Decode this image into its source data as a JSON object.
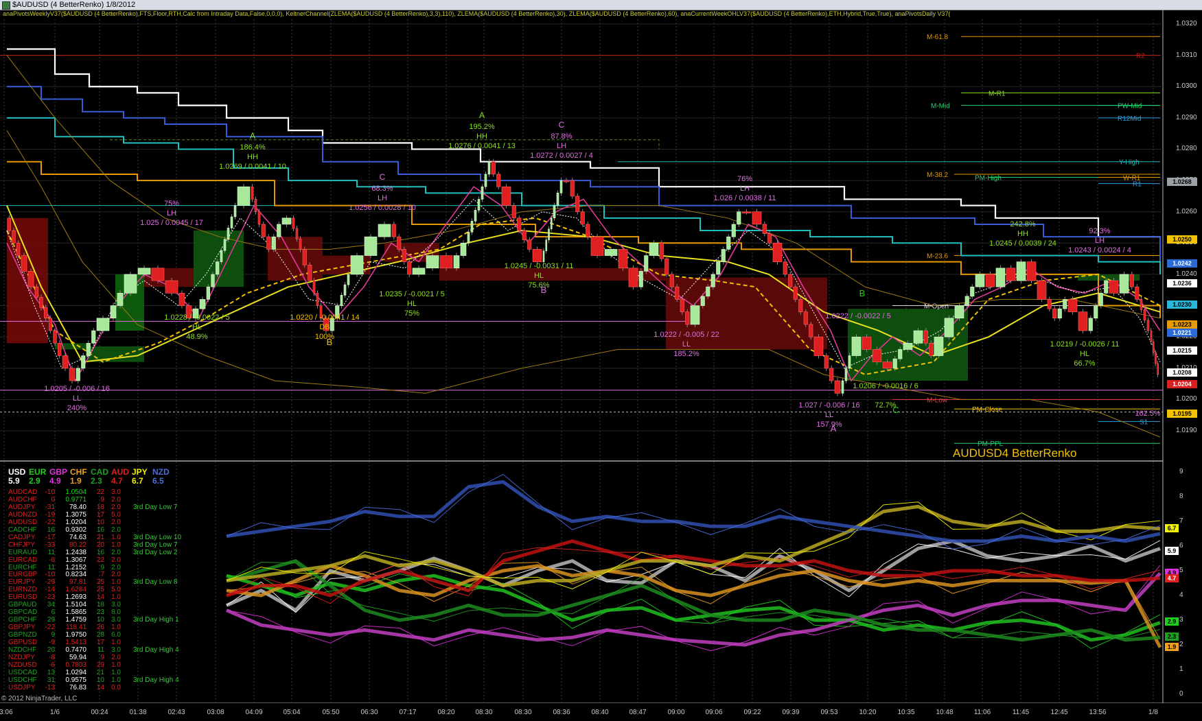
{
  "window": {
    "title": "$AUDUSD (4 BetterRenko)  1/8/2012"
  },
  "indicator_line": "anaPivotsWeeklyV37($AUDUSD (4 BetterRenko),FTS,Floor,RTH,Calc from Intraday Data,False,0,0,0), KeltnerChannel(ZLEMA($AUDUSD (4 BetterRenko),3,3),110), ZLEMA($AUDUSD (4 BetterRenko),30), ZLEMA($AUDUSD (4 BetterRenko),60), anaCurrentWeekOHLV37($AUDUSD (4 BetterRenko),ETH,Hybrid,True,True), anaPivotsDaily V37(",
  "instrument_label": "AUDUSD4 BetterRenko",
  "copyright": "© 2012 NinjaTrader, LLC",
  "price_axis": [
    "1.0320",
    "1.0310",
    "1.0300",
    "1.0290",
    "1.0280",
    "1.0270",
    "1.0260",
    "1.0250",
    "1.0240",
    "1.0230",
    "1.0220",
    "1.0210",
    "1.0200",
    "1.0190"
  ],
  "price_badges": [
    {
      "value": "1.0268",
      "color": "#9aa0a6",
      "text": "#000"
    },
    {
      "value": "1.0250",
      "color": "#f2c200",
      "text": "#000"
    },
    {
      "value": "1.0242",
      "color": "#2b6bd8",
      "text": "#fff"
    },
    {
      "value": "1.0236",
      "color": "#ffffff",
      "text": "#000"
    },
    {
      "value": "1.0230",
      "color": "#29b6d8",
      "text": "#000"
    },
    {
      "value": "1.0223",
      "color": "#e69a00",
      "text": "#000"
    },
    {
      "value": "1.0221",
      "color": "#2b6bd8",
      "text": "#fff"
    },
    {
      "value": "1.0215",
      "color": "#ffffff",
      "text": "#000"
    },
    {
      "value": "1.0208",
      "color": "#ffffff",
      "text": "#000"
    },
    {
      "value": "1.0204",
      "color": "#d82020",
      "text": "#fff"
    },
    {
      "value": "1.0195",
      "color": "#f2c200",
      "text": "#000"
    }
  ],
  "strength_axis": [
    "9",
    "8",
    "7",
    "6",
    "5",
    "4",
    "3",
    "2",
    "1",
    "0"
  ],
  "strength_badges": [
    {
      "value": "6.7",
      "color": "#f2f200",
      "text": "#000"
    },
    {
      "value": "5.9",
      "color": "#ffffff",
      "text": "#000"
    },
    {
      "value": "4.9",
      "color": "#e030e0",
      "text": "#000"
    },
    {
      "value": "4.7",
      "color": "#e02020",
      "text": "#fff"
    },
    {
      "value": "2.9",
      "color": "#20d020",
      "text": "#000"
    },
    {
      "value": "2.3",
      "color": "#20a020",
      "text": "#000"
    },
    {
      "value": "1.9",
      "color": "#f0a020",
      "text": "#000"
    }
  ],
  "time_axis": [
    "23:06",
    "1/6",
    "00:24",
    "01:38",
    "02:43",
    "03:08",
    "04:09",
    "05:04",
    "05:50",
    "06:30",
    "07:17",
    "08:20",
    "08:30",
    "08:30",
    "08:36",
    "08:40",
    "08:47",
    "09:00",
    "09:06",
    "09:22",
    "09:39",
    "09:53",
    "10:20",
    "10:35",
    "10:48",
    "11:06",
    "11:45",
    "12:45",
    "13:56",
    "1/8"
  ],
  "currencies": [
    {
      "code": "USD",
      "value": "5.9",
      "color": "#ffffff"
    },
    {
      "code": "EUR",
      "value": "2.9",
      "color": "#20d020"
    },
    {
      "code": "GBP",
      "value": "4.9",
      "color": "#e030e0"
    },
    {
      "code": "CHF",
      "value": "1.9",
      "color": "#f0a020"
    },
    {
      "code": "CAD",
      "value": "2.3",
      "color": "#20a020"
    },
    {
      "code": "AUD",
      "value": "4.7",
      "color": "#e02020"
    },
    {
      "code": "JPY",
      "value": "6.7",
      "color": "#f2f200"
    },
    {
      "code": "NZD",
      "value": "6.5",
      "color": "#4a6ee0"
    }
  ],
  "pairs": [
    {
      "name": "AUDCAD",
      "a": "-10",
      "price": "1.0504",
      "b": "22",
      "c": "3.0",
      "note": "",
      "color": "#e02020",
      "pcolor": "#20d020"
    },
    {
      "name": "AUDCHF",
      "a": "0",
      "price": "0.9771",
      "b": "9",
      "c": "2.0",
      "note": "",
      "color": "#e02020",
      "pcolor": "#20d020"
    },
    {
      "name": "AUDJPY",
      "a": "-31",
      "price": "78.40",
      "b": "18",
      "c": "2.0",
      "note": "3rd Day Low 7",
      "color": "#e02020",
      "pcolor": "#ffffff"
    },
    {
      "name": "AUDNZD",
      "a": "-19",
      "price": "1.3075",
      "b": "17",
      "c": "5.0",
      "note": "",
      "color": "#e02020",
      "pcolor": "#ffffff"
    },
    {
      "name": "AUDUSD",
      "a": "-22",
      "price": "1.0204",
      "b": "10",
      "c": "2.0",
      "note": "",
      "color": "#e02020",
      "pcolor": "#ffffff"
    },
    {
      "name": "CADCHF",
      "a": "16",
      "price": "0.9302",
      "b": "16",
      "c": "2.0",
      "note": "",
      "color": "#20a020",
      "pcolor": "#ffffff"
    },
    {
      "name": "CADJPY",
      "a": "-17",
      "price": "74.63",
      "b": "21",
      "c": "1.0",
      "note": "3rd Day Low 10",
      "color": "#e02020",
      "pcolor": "#ffffff"
    },
    {
      "name": "CHFJPY",
      "a": "-33",
      "price": "80.22",
      "b": "20",
      "c": "1.0",
      "note": "3rd Day Low 7",
      "color": "#e02020",
      "pcolor": "#e02020"
    },
    {
      "name": "EURAUD",
      "a": "11",
      "price": "1.2438",
      "b": "16",
      "c": "2.0",
      "note": "3rd Day Low 2",
      "color": "#20a020",
      "pcolor": "#ffffff"
    },
    {
      "name": "EURCAD",
      "a": "-6",
      "price": "1.3067",
      "b": "22",
      "c": "2.0",
      "note": "",
      "color": "#e02020",
      "pcolor": "#ffffff"
    },
    {
      "name": "EURCHF",
      "a": "11",
      "price": "1.2152",
      "b": "9",
      "c": "2.0",
      "note": "",
      "color": "#20a020",
      "pcolor": "#ffffff"
    },
    {
      "name": "EURGBP",
      "a": "-10",
      "price": "0.8234",
      "b": "7",
      "c": "2.0",
      "note": "",
      "color": "#e02020",
      "pcolor": "#ffffff"
    },
    {
      "name": "EURJPY",
      "a": "-29",
      "price": "97.81",
      "b": "25",
      "c": "1.0",
      "note": "3rd Day Low 8",
      "color": "#e02020",
      "pcolor": "#e02020"
    },
    {
      "name": "EURNZD",
      "a": "-14",
      "price": "1.6284",
      "b": "25",
      "c": "5.0",
      "note": "",
      "color": "#e02020",
      "pcolor": "#e02020"
    },
    {
      "name": "EURUSD",
      "a": "-23",
      "price": "1.2693",
      "b": "14",
      "c": "1.0",
      "note": "",
      "color": "#e02020",
      "pcolor": "#ffffff"
    },
    {
      "name": "GBPAUD",
      "a": "34",
      "price": "1.5104",
      "b": "18",
      "c": "3.0",
      "note": "",
      "color": "#20a020",
      "pcolor": "#ffffff"
    },
    {
      "name": "GBPCAD",
      "a": "6",
      "price": "1.5865",
      "b": "23",
      "c": "8.0",
      "note": "",
      "color": "#20a020",
      "pcolor": "#ffffff"
    },
    {
      "name": "GBPCHF",
      "a": "29",
      "price": "1.4759",
      "b": "10",
      "c": "3.0",
      "note": "3rd Day High 1",
      "color": "#20a020",
      "pcolor": "#ffffff"
    },
    {
      "name": "GBPJPY",
      "a": "-22",
      "price": "118.41",
      "b": "26",
      "c": "1.0",
      "note": "",
      "color": "#e02020",
      "pcolor": "#e02020"
    },
    {
      "name": "GBPNZD",
      "a": "9",
      "price": "1.9750",
      "b": "28",
      "c": "6.0",
      "note": "",
      "color": "#20a020",
      "pcolor": "#ffffff"
    },
    {
      "name": "GBPUSD",
      "a": "-9",
      "price": "1.5413",
      "b": "17",
      "c": "1.0",
      "note": "",
      "color": "#e02020",
      "pcolor": "#e02020"
    },
    {
      "name": "NZDCHF",
      "a": "20",
      "price": "0.7470",
      "b": "11",
      "c": "3.0",
      "note": "3rd Day High 4",
      "color": "#20a020",
      "pcolor": "#ffffff"
    },
    {
      "name": "NZDJPY",
      "a": "-8",
      "price": "59.94",
      "b": "9",
      "c": "2.0",
      "note": "",
      "color": "#e02020",
      "pcolor": "#ffffff"
    },
    {
      "name": "NZDUSD",
      "a": "-6",
      "price": "0.7803",
      "b": "29",
      "c": "1.0",
      "note": "",
      "color": "#e02020",
      "pcolor": "#e02020"
    },
    {
      "name": "USDCAD",
      "a": "13",
      "price": "1.0294",
      "b": "21",
      "c": "1.0",
      "note": "",
      "color": "#20a020",
      "pcolor": "#ffffff"
    },
    {
      "name": "USDCHF",
      "a": "31",
      "price": "0.9575",
      "b": "10",
      "c": "1.0",
      "note": "3rd Day High 4",
      "color": "#20a020",
      "pcolor": "#ffffff"
    },
    {
      "name": "USDJPY",
      "a": "-13",
      "price": "76.83",
      "b": "14",
      "c": "0.0",
      "note": "",
      "color": "#e02020",
      "pcolor": "#ffffff"
    }
  ],
  "pivot_labels": [
    {
      "text": "M-61.8",
      "color": "#e69a00"
    },
    {
      "text": "R2",
      "color": "#29a0e0"
    },
    {
      "text": "M-R1",
      "color": "#8ee020"
    },
    {
      "text": "M-Mid",
      "color": "#20d070"
    },
    {
      "text": "PW-Mid",
      "color": "#20d070"
    },
    {
      "text": "R12Mid",
      "color": "#29a0e0"
    },
    {
      "text": "Y-High",
      "color": "#20c0c0"
    },
    {
      "text": "M-38.2",
      "color": "#e69a00"
    },
    {
      "text": "PM-High",
      "color": "#20d070"
    },
    {
      "text": "W-R1",
      "color": "#e69a00"
    },
    {
      "text": "R1",
      "color": "#29a0e0"
    },
    {
      "text": "M-23.6",
      "color": "#e69a00"
    },
    {
      "text": "M-Open",
      "color": "#dddddd"
    },
    {
      "text": "M-Low",
      "color": "#e04040"
    },
    {
      "text": "PM-Close",
      "color": "#f2c200"
    },
    {
      "text": "PM-PPL",
      "color": "#20d070"
    },
    {
      "text": "S1",
      "color": "#29a0e0"
    }
  ],
  "swing_labels": [
    {
      "lines": [
        "186.4%",
        "HH",
        "1.0269 / 0.0041 / 10"
      ],
      "color": "#8ee020",
      "top": "A"
    },
    {
      "lines": [
        "75%",
        "LH",
        "1.025 / 0.0045 / 17"
      ],
      "color": "#e070e0",
      "top": ""
    },
    {
      "lines": [
        "1.0228 / -0.0022 / 5",
        "HL",
        "48.9%"
      ],
      "color": "#8ee020",
      "top": ""
    },
    {
      "lines": [
        "1.0205 / -0.006 / 16",
        "LL",
        "240%"
      ],
      "color": "#e070e0",
      "top": ""
    },
    {
      "lines": [
        "1.0220 / -0.0041 / 14",
        "DB",
        "100%"
      ],
      "color": "#f2c200",
      "top": ""
    },
    {
      "lines": [
        "68.3%",
        "LH",
        "1.0256 / 0.0028 / 10"
      ],
      "color": "#e070e0",
      "top": "C"
    },
    {
      "lines": [
        "1.0235 / -0.0021 / 5",
        "HL",
        "75%"
      ],
      "color": "#8ee020",
      "top": ""
    },
    {
      "lines": [
        "195.2%",
        "HH",
        "1.0276 / 0.0041 / 13"
      ],
      "color": "#8ee020",
      "top": "A"
    },
    {
      "lines": [
        "87.8%",
        "LH",
        "1.0272 / 0.0027 / 4"
      ],
      "color": "#e070e0",
      "top": "C"
    },
    {
      "lines": [
        "1.0245 / -0.0031 / 11",
        "HL",
        "75.6%"
      ],
      "color": "#8ee020",
      "top": ""
    },
    {
      "lines": [
        "76%",
        "LH",
        "1.026 / 0.0038 / 11"
      ],
      "color": "#e070e0",
      "top": ""
    },
    {
      "lines": [
        "1.0222 / -0.005 / 22",
        "LL",
        "185.2%"
      ],
      "color": "#e070e0",
      "top": ""
    },
    {
      "lines": [
        "1.027 / -0.006 / 16",
        "LL",
        "157.9%"
      ],
      "color": "#e070e0",
      "top": ""
    },
    {
      "lines": [
        "1.0206 / -0.0016 / 6",
        "",
        "72.7%"
      ],
      "color": "#8ee020",
      "top": ""
    },
    {
      "lines": [
        "1.0222 / -0.0022 / 5"
      ],
      "color": "#e070e0",
      "top": ""
    },
    {
      "lines": [
        "242.8%",
        "HH",
        "1.0245 / 0.0039 / 24"
      ],
      "color": "#8ee020",
      "top": ""
    },
    {
      "lines": [
        "92.3%",
        "LH",
        "1.0243 / 0.0024 / 4"
      ],
      "color": "#e070e0",
      "top": ""
    },
    {
      "lines": [
        "1.0219 / -0.0026 / 11",
        "HL",
        "66.7%"
      ],
      "color": "#8ee020",
      "top": ""
    },
    {
      "lines": [
        "162.5%"
      ],
      "color": "#e070e0",
      "top": ""
    }
  ],
  "wave_letters": [
    {
      "text": "B",
      "color": "#f2c200"
    },
    {
      "text": "B",
      "color": "#e070e0"
    },
    {
      "text": "A",
      "color": "#e070e0"
    },
    {
      "text": "C",
      "color": "#20d020"
    },
    {
      "text": "B",
      "color": "#20d020"
    }
  ]
}
